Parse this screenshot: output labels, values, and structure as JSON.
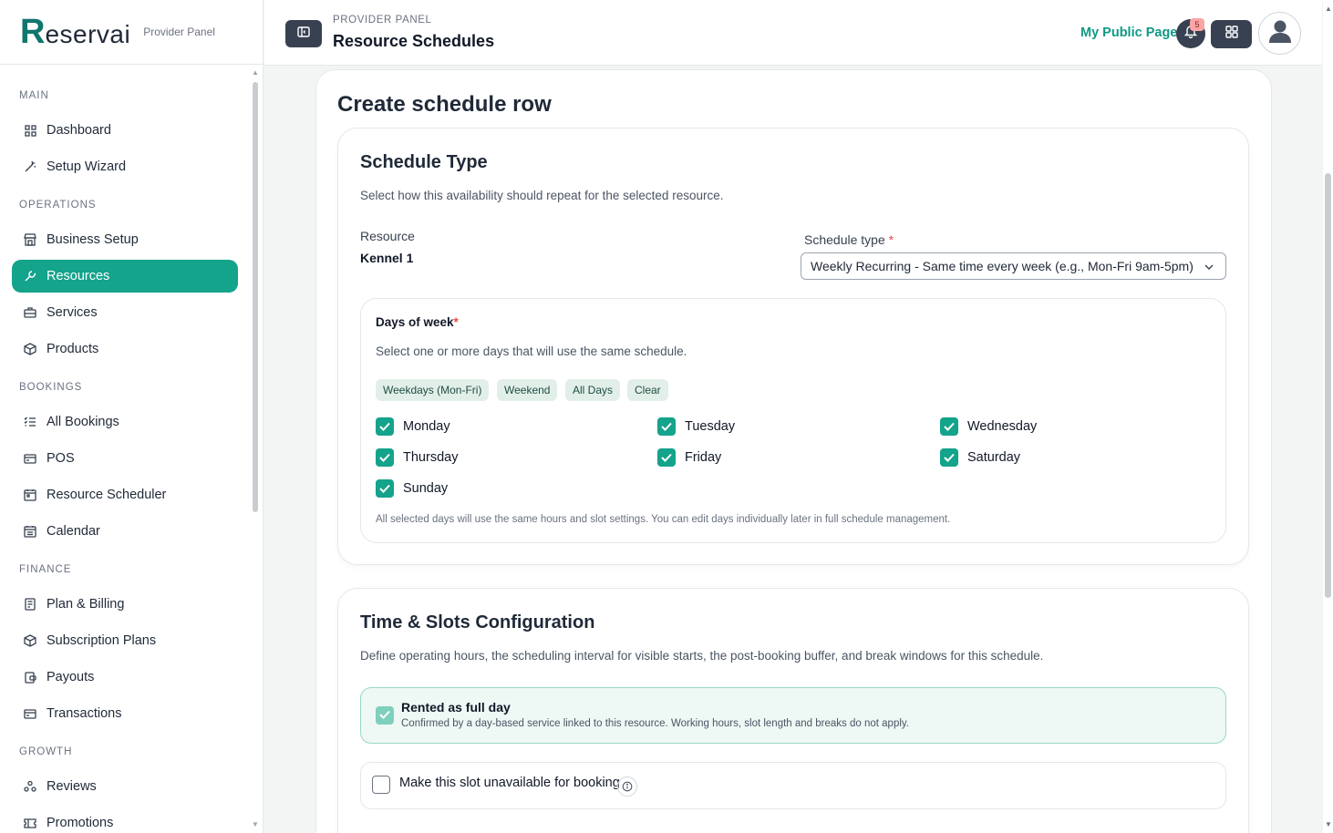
{
  "brand": {
    "logo_initial": "R",
    "logo_rest": "eservai",
    "subtitle": "Provider Panel"
  },
  "sidebar": {
    "sections": [
      {
        "title": "MAIN",
        "items": [
          {
            "label": "Dashboard",
            "icon": "grid-icon"
          },
          {
            "label": "Setup Wizard",
            "icon": "wand-icon"
          }
        ]
      },
      {
        "title": "OPERATIONS",
        "items": [
          {
            "label": "Business Setup",
            "icon": "store-icon"
          },
          {
            "label": "Resources",
            "icon": "wrench-icon",
            "active": true
          },
          {
            "label": "Services",
            "icon": "briefcase-icon"
          },
          {
            "label": "Products",
            "icon": "box-icon"
          }
        ]
      },
      {
        "title": "BOOKINGS",
        "items": [
          {
            "label": "All Bookings",
            "icon": "list-icon"
          },
          {
            "label": "POS",
            "icon": "card-icon"
          },
          {
            "label": "Resource Scheduler",
            "icon": "calendar-icon"
          },
          {
            "label": "Calendar",
            "icon": "calendar-grid-icon"
          }
        ]
      },
      {
        "title": "FINANCE",
        "items": [
          {
            "label": "Plan & Billing",
            "icon": "receipt-icon"
          },
          {
            "label": "Subscription Plans",
            "icon": "box-icon"
          },
          {
            "label": "Payouts",
            "icon": "wallet-icon"
          },
          {
            "label": "Transactions",
            "icon": "card-icon"
          }
        ]
      },
      {
        "title": "GROWTH",
        "items": [
          {
            "label": "Reviews",
            "icon": "people-icon"
          },
          {
            "label": "Promotions",
            "icon": "ticket-icon"
          }
        ]
      }
    ]
  },
  "header": {
    "breadcrumb": "PROVIDER PANEL",
    "title": "Resource Schedules",
    "public_link": "My Public Page",
    "notification_count": "5"
  },
  "page": {
    "heading": "Create schedule row"
  },
  "schedule_type": {
    "title": "Schedule Type",
    "subtitle": "Select how this availability should repeat for the selected resource.",
    "resource_label": "Resource",
    "resource_value": "Kennel 1",
    "type_label": "Schedule type",
    "required_mark": "*",
    "type_value": "Weekly Recurring - Same time every week (e.g., Mon-Fri 9am-5pm)"
  },
  "days": {
    "title": "Days of week",
    "required_mark": "*",
    "subtitle": "Select one or more days that will use the same schedule.",
    "chips": [
      "Weekdays (Mon-Fri)",
      "Weekend",
      "All Days",
      "Clear"
    ],
    "items": [
      {
        "label": "Monday",
        "checked": true
      },
      {
        "label": "Tuesday",
        "checked": true
      },
      {
        "label": "Wednesday",
        "checked": true
      },
      {
        "label": "Thursday",
        "checked": true
      },
      {
        "label": "Friday",
        "checked": true
      },
      {
        "label": "Saturday",
        "checked": true
      },
      {
        "label": "Sunday",
        "checked": true
      }
    ],
    "note": "All selected days will use the same hours and slot settings. You can edit days individually later in full schedule management."
  },
  "time_slots": {
    "title": "Time & Slots Configuration",
    "subtitle": "Define operating hours, the scheduling interval for visible starts, the post-booking buffer, and break windows for this schedule.",
    "full_day_label": "Rented as full day",
    "full_day_checked": true,
    "full_day_sub": "Confirmed by a day-based service linked to this resource. Working hours, slot length and breaks do not apply.",
    "unavailable_label": "Make this slot unavailable for booking",
    "unavailable_checked": false
  },
  "colors": {
    "accent": "#14a38b",
    "dark": "#374151"
  }
}
